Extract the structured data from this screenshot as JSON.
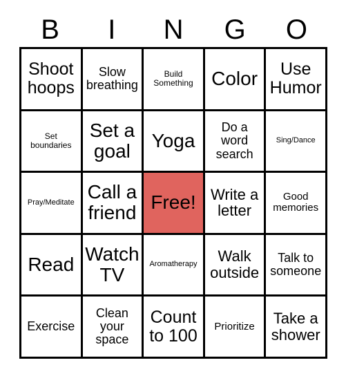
{
  "card": {
    "title": "BINGO",
    "header_letters": [
      "B",
      "I",
      "N",
      "G",
      "O"
    ],
    "free_cell_color": "#e0645e",
    "grid_line_color": "#000000",
    "background_color": "#ffffff",
    "rows": 5,
    "columns": 5,
    "cells": [
      {
        "text": "Shoot hoops",
        "size": "fs-xl",
        "free": false
      },
      {
        "text": "Slow breathing",
        "size": "fs-md",
        "free": false
      },
      {
        "text": "Build Something",
        "size": "fs-xs",
        "free": false
      },
      {
        "text": "Color",
        "size": "fs-xxl",
        "free": false
      },
      {
        "text": "Use Humor",
        "size": "fs-xl",
        "free": false
      },
      {
        "text": "Set boundaries",
        "size": "fs-xs",
        "free": false
      },
      {
        "text": "Set a goal",
        "size": "fs-xxl",
        "free": false
      },
      {
        "text": "Yoga",
        "size": "fs-xxl",
        "free": false
      },
      {
        "text": "Do a word search",
        "size": "fs-md",
        "free": false
      },
      {
        "text": "Sing/Dance",
        "size": "fs-xxs",
        "free": false
      },
      {
        "text": "Pray/Meditate",
        "size": "fs-xxs",
        "free": false
      },
      {
        "text": "Call a friend",
        "size": "fs-xxl",
        "free": false
      },
      {
        "text": "Free!",
        "size": "fs-xxl",
        "free": true
      },
      {
        "text": "Write a letter",
        "size": "fs-lg",
        "free": false
      },
      {
        "text": "Good memories",
        "size": "fs-sm",
        "free": false
      },
      {
        "text": "Read",
        "size": "fs-xxl",
        "free": false
      },
      {
        "text": "Watch TV",
        "size": "fs-xxl",
        "free": false
      },
      {
        "text": "Aromatherapy",
        "size": "fs-xxs",
        "free": false
      },
      {
        "text": "Walk outside",
        "size": "fs-lg",
        "free": false
      },
      {
        "text": "Talk to someone",
        "size": "fs-md",
        "free": false
      },
      {
        "text": "Exercise",
        "size": "fs-md",
        "free": false
      },
      {
        "text": "Clean your space",
        "size": "fs-md",
        "free": false
      },
      {
        "text": "Count to 100",
        "size": "fs-xl",
        "free": false
      },
      {
        "text": "Prioritize",
        "size": "fs-sm",
        "free": false
      },
      {
        "text": "Take a shower",
        "size": "fs-lg",
        "free": false
      }
    ]
  }
}
